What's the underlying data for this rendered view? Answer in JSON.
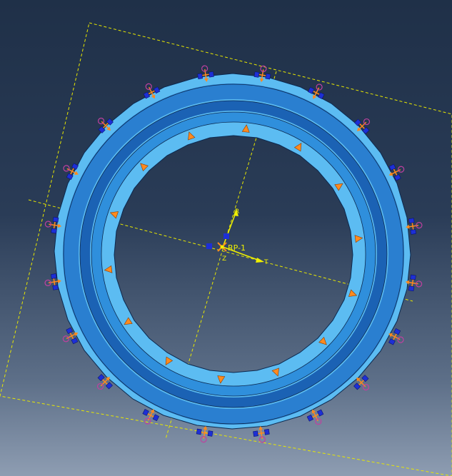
{
  "viewport": {
    "ref_point_label": "RP-1",
    "axis_labels": {
      "r": "R",
      "t": "T",
      "z": "Z"
    },
    "colors": {
      "ring_light": "#5cbcf2",
      "ring_mid": "#3a9be0",
      "ring_dark": "#1f6fc0",
      "edge": "#0b2950",
      "load_arrow": "#ff8a1e",
      "constraint": "#1d2fd6",
      "csys": "#f0f000"
    }
  }
}
